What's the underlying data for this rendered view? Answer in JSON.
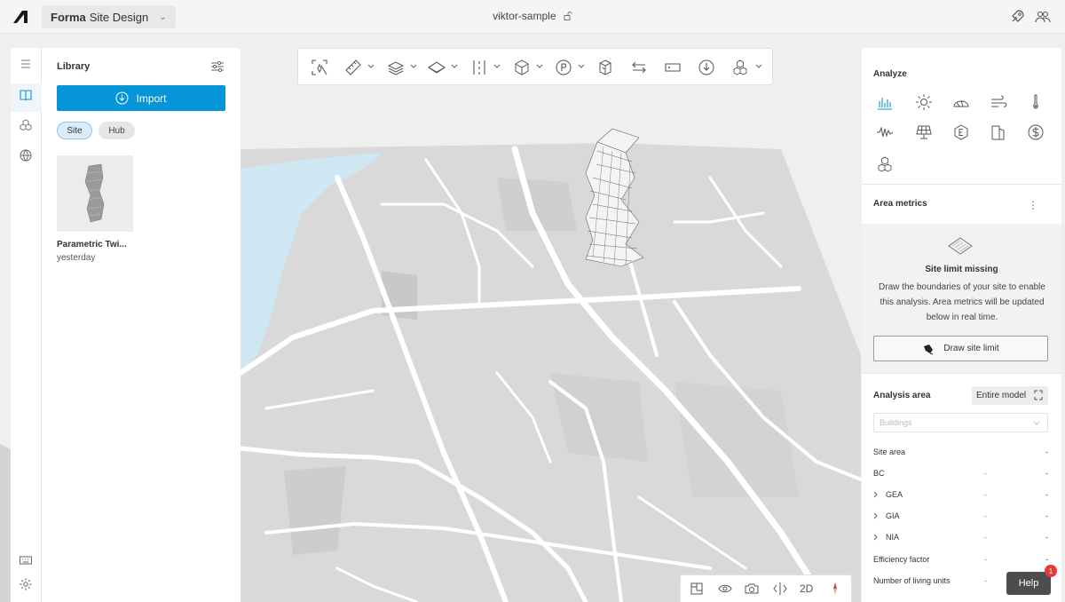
{
  "topbar": {
    "product_brand": "Forma",
    "product_name": "Site Design",
    "project_name": "viktor-sample"
  },
  "library": {
    "title": "Library",
    "import_label": "Import",
    "tabs": [
      {
        "label": "Site",
        "active": true
      },
      {
        "label": "Hub",
        "active": false
      }
    ],
    "items": [
      {
        "name": "Parametric Twi...",
        "date": "yesterday"
      }
    ]
  },
  "bottom_toolbar": {
    "view_2d_label": "2D"
  },
  "right_panel": {
    "analyze_title": "Analyze",
    "area_metrics_title": "Area metrics",
    "site_limit": {
      "title": "Site limit missing",
      "description": "Draw the boundaries of your site to enable this analysis. Area metrics will be updated below in real time.",
      "button_label": "Draw site limit"
    },
    "analysis_area_label": "Analysis area",
    "analysis_area_value": "Entire model",
    "buildings_placeholder": "Buildings",
    "metrics": [
      {
        "label": "Site area",
        "expandable": false,
        "value1": "",
        "value2": "-"
      },
      {
        "label": "BC",
        "expandable": false,
        "value1": "-",
        "value2": "-"
      },
      {
        "label": "GEA",
        "expandable": true,
        "value1": "-",
        "value2": "-"
      },
      {
        "label": "GIA",
        "expandable": true,
        "value1": "-",
        "value2": "-"
      },
      {
        "label": "NIA",
        "expandable": true,
        "value1": "-",
        "value2": "-"
      },
      {
        "label": "Efficiency factor",
        "expandable": false,
        "value1": "-",
        "value2": "-"
      },
      {
        "label": "Number of living units",
        "expandable": false,
        "value1": "-",
        "value2": "-"
      }
    ]
  },
  "help": {
    "label": "Help",
    "badge_count": "1"
  },
  "colors": {
    "accent": "#0696d7",
    "water": "#cfe6f3",
    "map_block": "#d6d6d6",
    "road": "#ffffff"
  }
}
